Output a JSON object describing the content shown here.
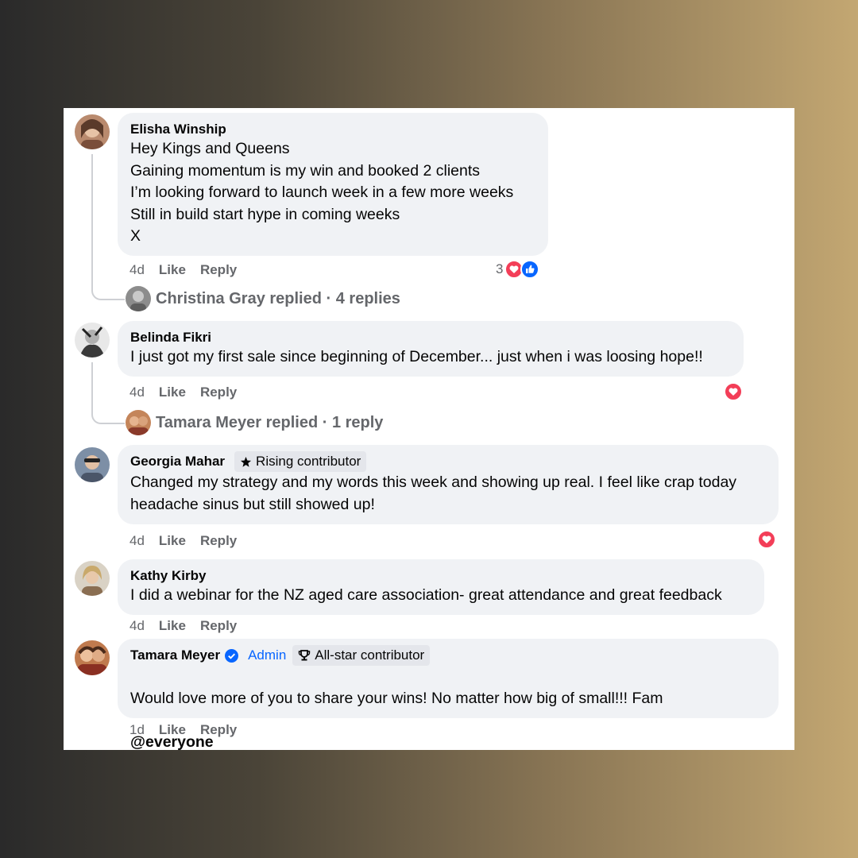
{
  "comments": [
    {
      "author": "Elisha Winship",
      "text": "Hey Kings and Queens\nGaining momentum is my win and booked 2 clients\nI’m looking forward to launch week in a few more weeks\nStill in build start hype in coming weeks\nX",
      "time": "4d",
      "like": "Like",
      "reply": "Reply",
      "reaction_count": "3",
      "reactions": [
        "love-icon",
        "like-icon"
      ],
      "replies_text": "Christina Gray replied · 4 replies"
    },
    {
      "author": "Belinda Fikri",
      "text": "I just got my first sale since beginning of December... just when i was loosing hope!!",
      "time": "4d",
      "like": "Like",
      "reply": "Reply",
      "reactions": [
        "love-icon"
      ],
      "replies_text": "Tamara Meyer replied · 1 reply"
    },
    {
      "author": "Georgia Mahar",
      "badge": "Rising contributor",
      "text": "Changed my strategy and my words this week and showing up real. I feel like crap today\nheadache sinus but still showed up!",
      "time": "4d",
      "like": "Like",
      "reply": "Reply",
      "reactions": [
        "love-icon"
      ]
    },
    {
      "author": "Kathy Kirby",
      "text": "I did a webinar for the NZ aged care association- great attendance and great feedback",
      "time": "4d",
      "like": "Like",
      "reply": "Reply"
    },
    {
      "author": "Tamara Meyer",
      "role": "Admin",
      "badge": "All-star contributor",
      "text": "Would love more of you to share your wins! No matter how big of small!!! Fam",
      "mention": "@everyone",
      "time": "1d",
      "like": "Like",
      "reply": "Reply"
    }
  ],
  "colors": {
    "bubble": "#f0f2f5",
    "meta": "#65676b",
    "admin": "#0866ff",
    "love": "#f33e58",
    "like": "#0866ff"
  }
}
